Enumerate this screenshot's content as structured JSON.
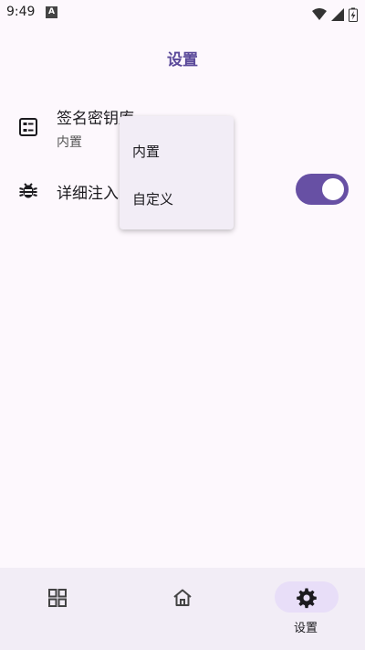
{
  "status_bar": {
    "time": "9:49",
    "notification_letter": "A"
  },
  "app_bar": {
    "title": "设置"
  },
  "settings": {
    "signature_key": {
      "title": "签名密钥库",
      "value": "内置",
      "icon": "keystore-icon"
    },
    "verbose_injection": {
      "title": "详细注入",
      "enabled": true,
      "icon": "bug-icon"
    }
  },
  "dropdown": {
    "options": [
      "内置",
      "自定义"
    ]
  },
  "bottom_nav": {
    "items": [
      {
        "icon": "grid-icon",
        "label": ""
      },
      {
        "icon": "home-icon",
        "label": ""
      },
      {
        "icon": "gear-icon",
        "label": "设置",
        "selected": true
      }
    ]
  },
  "colors": {
    "primary": "#6750a4",
    "title": "#5b4a9a",
    "background": "#fdf8fd",
    "nav_background": "#f2edf6",
    "nav_selected": "#e8def8"
  }
}
